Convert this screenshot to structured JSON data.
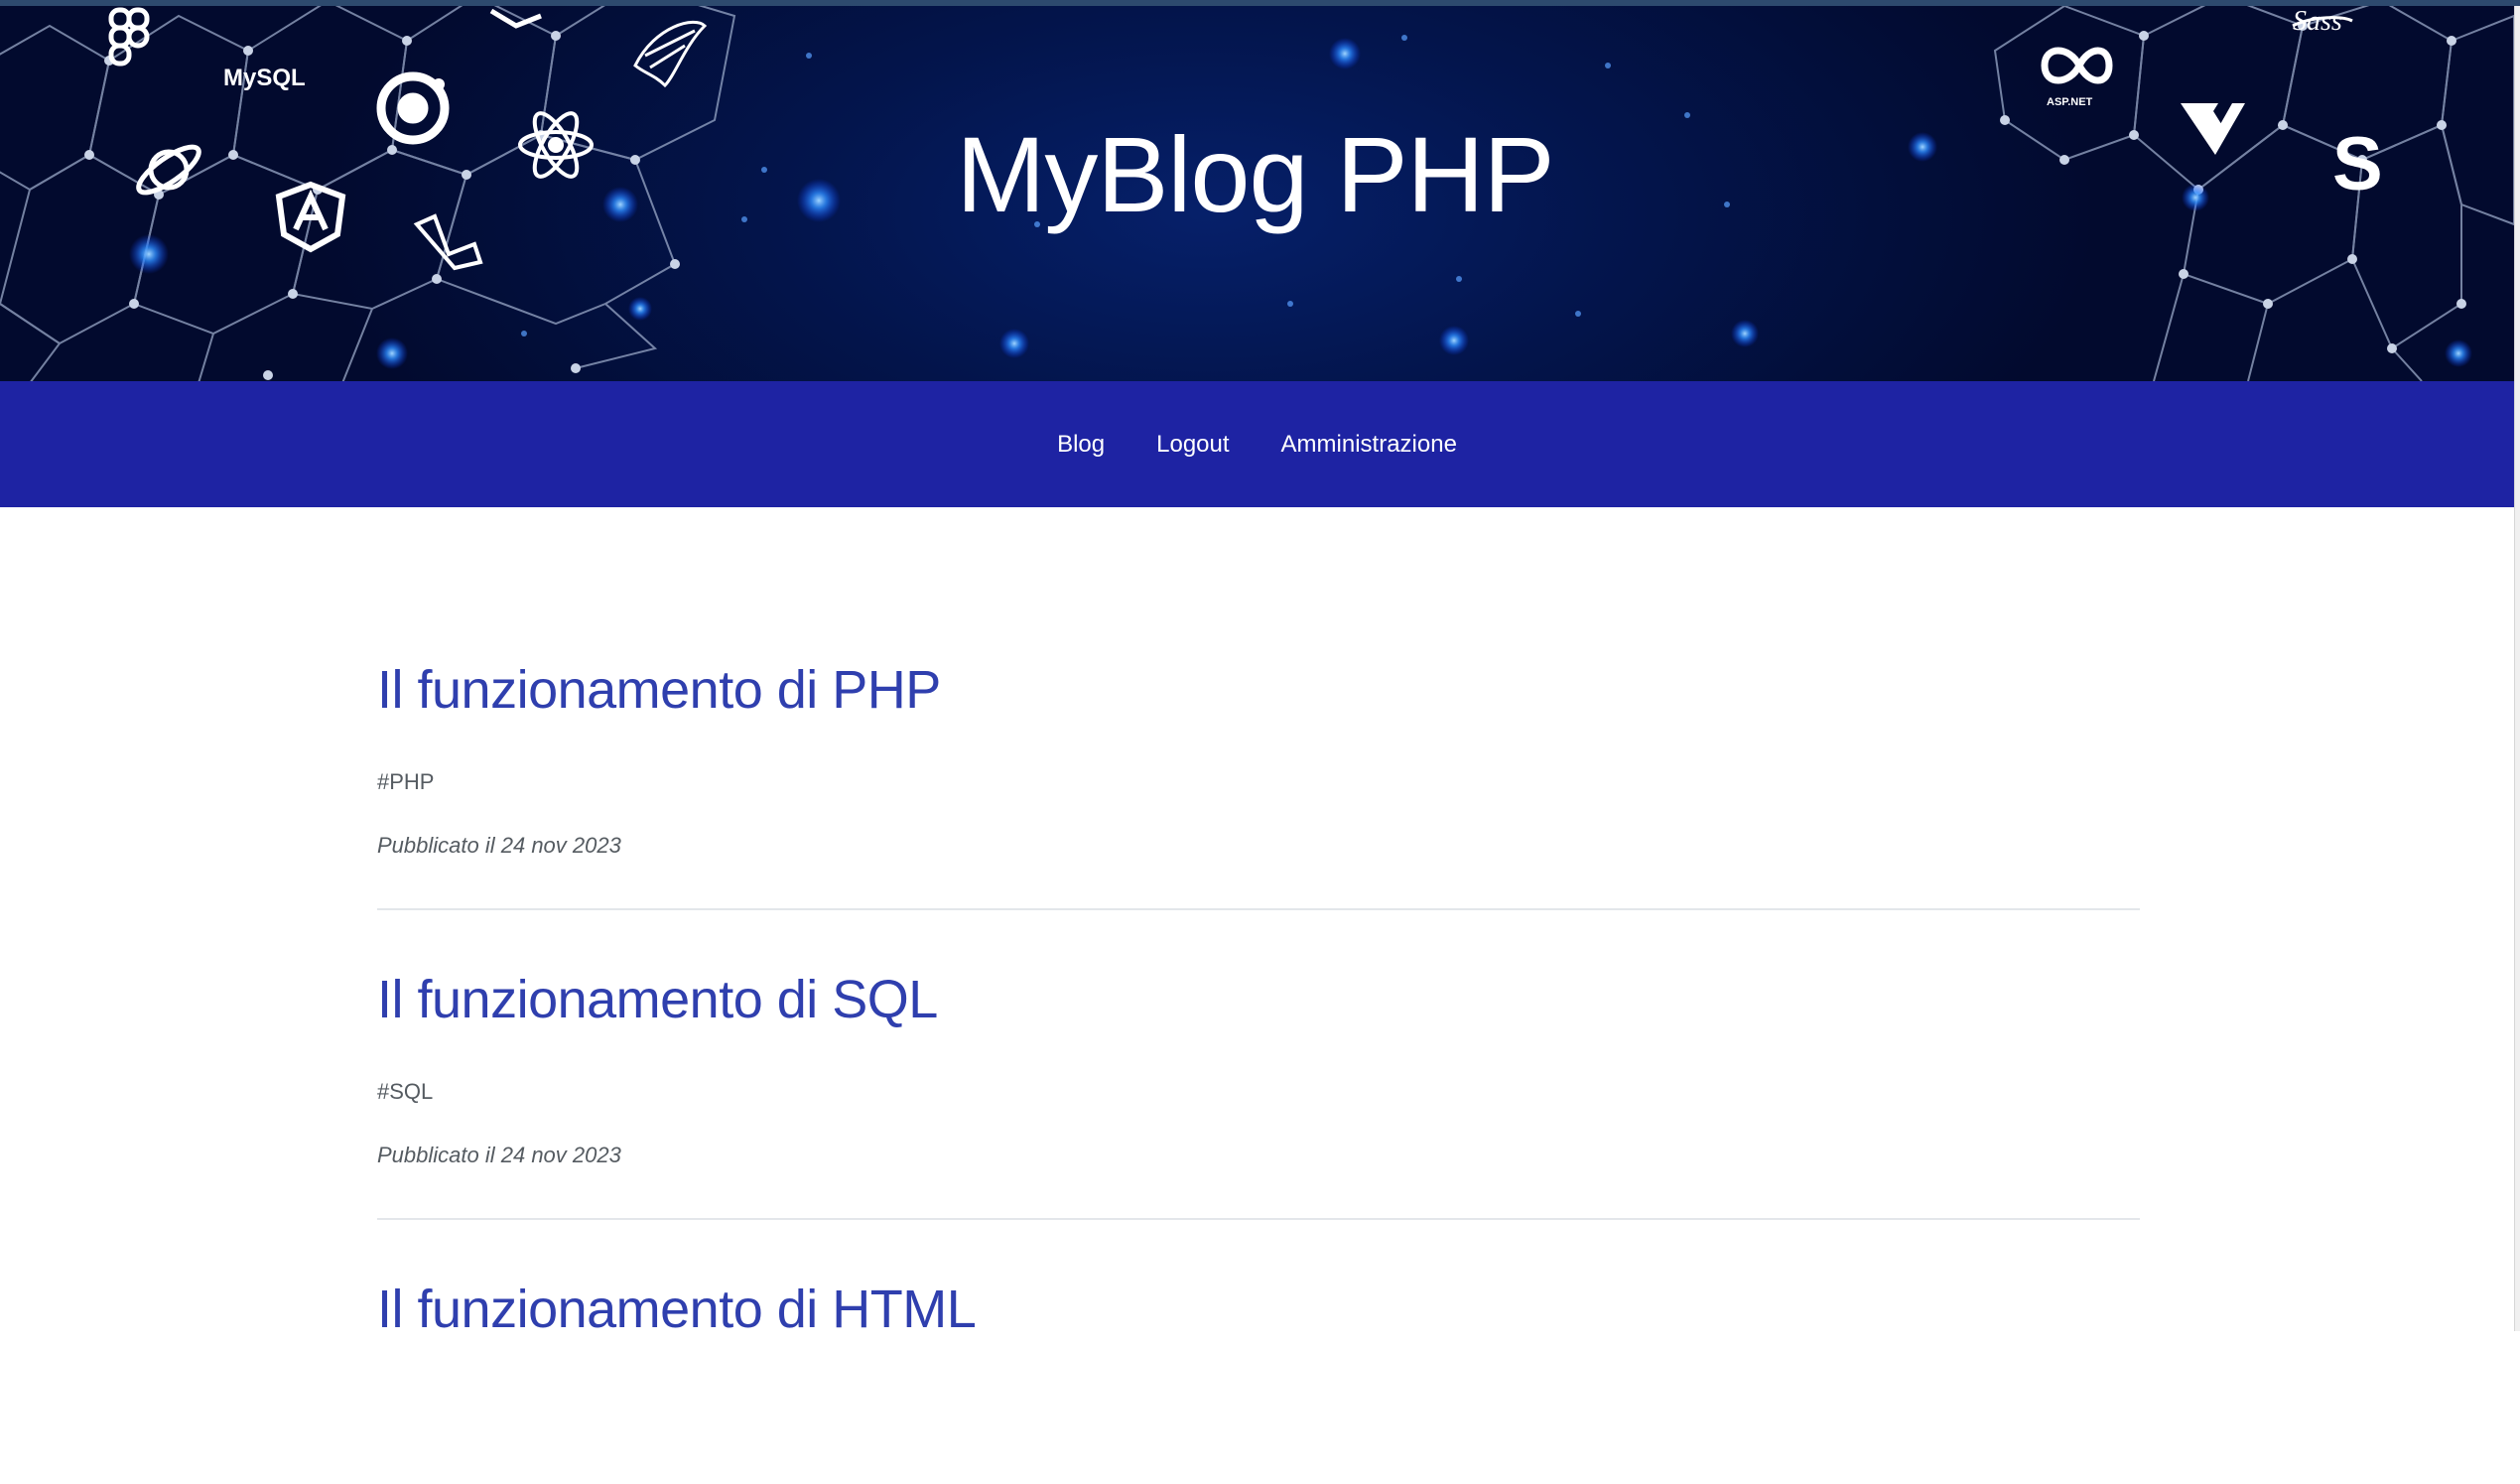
{
  "header": {
    "title": "MyBlog PHP",
    "logo_text_left": "MySQL",
    "logo_text_right": "ASP.NET",
    "logo_text_sass": "Sass"
  },
  "nav": {
    "items": [
      {
        "label": "Blog"
      },
      {
        "label": "Logout"
      },
      {
        "label": "Amministrazione"
      }
    ]
  },
  "posts": [
    {
      "title": "Il funzionamento di PHP",
      "tag": "#PHP",
      "date": "Pubblicato il 24 nov 2023"
    },
    {
      "title": "Il funzionamento di SQL",
      "tag": "#SQL",
      "date": "Pubblicato il 24 nov 2023"
    },
    {
      "title": "Il funzionamento di HTML"
    }
  ],
  "colors": {
    "nav_background": "#1e23a3",
    "post_title": "#2f3fae",
    "banner": "#03154d"
  }
}
